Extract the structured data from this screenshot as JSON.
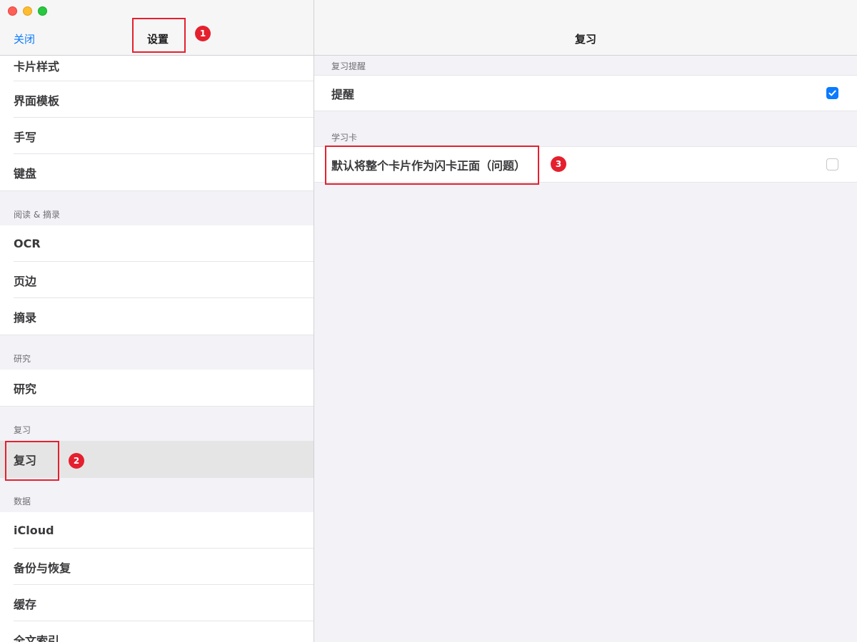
{
  "sidebar": {
    "close_label": "关闭",
    "title": "设置",
    "rows_group1": [
      "卡片样式",
      "界面模板",
      "手写",
      "键盘"
    ],
    "section_reading": "阅读 & 摘录",
    "rows_reading": [
      "OCR",
      "页边",
      "摘录"
    ],
    "section_research": "研究",
    "rows_research": [
      "研究"
    ],
    "section_review": "复习",
    "rows_review": [
      "复习"
    ],
    "section_data": "数据",
    "rows_data": [
      "iCloud",
      "备份与恢复",
      "缓存",
      "全文索引"
    ]
  },
  "detail": {
    "title": "复习",
    "section_reminder": "复习提醒",
    "reminder_label": "提醒",
    "reminder_checked": true,
    "section_flashcard": "学习卡",
    "flashcard_label": "默认将整个卡片作为闪卡正面（问题）",
    "flashcard_checked": false
  },
  "annotations": {
    "badge1": "1",
    "badge2": "2",
    "badge3": "3"
  },
  "colors": {
    "accent": "#0a7aff",
    "annotation": "#e5202e"
  }
}
